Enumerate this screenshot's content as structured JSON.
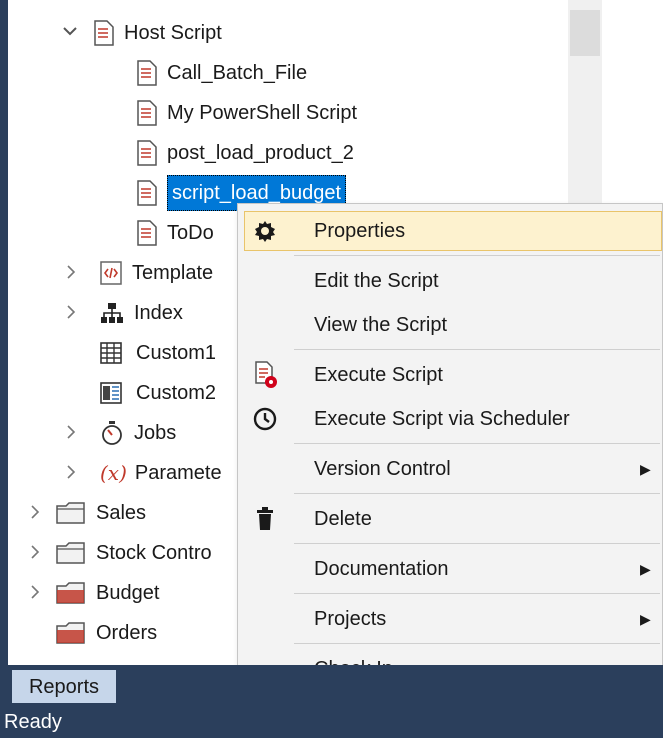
{
  "tree": {
    "host_script": "Host Script",
    "scripts": [
      "Call_Batch_File",
      "My PowerShell Script",
      "post_load_product_2",
      "script_load_budget",
      "ToDo"
    ],
    "templates": "Template",
    "index": "Index",
    "custom1": "Custom1",
    "custom2": "Custom2",
    "jobs": "Jobs",
    "parameters": "Paramete",
    "param_symbol": "(x)",
    "sales": "Sales",
    "stock_control": "Stock Contro",
    "budget": "Budget",
    "orders": "Orders"
  },
  "context_menu": {
    "items": [
      "Properties",
      "Edit the Script",
      "View the Script",
      "Execute Script",
      "Execute Script via Scheduler",
      "Version Control",
      "Delete",
      "Documentation",
      "Projects",
      "Check In"
    ],
    "submenu_arrow": "▶"
  },
  "tabs": {
    "reports": "Reports"
  },
  "status": {
    "text": "Ready"
  },
  "colors": {
    "selection": "#0078d7",
    "frame": "#2b3f5c",
    "menu_highlight": "#fdf2cf",
    "tab": "#c6d6ea"
  }
}
